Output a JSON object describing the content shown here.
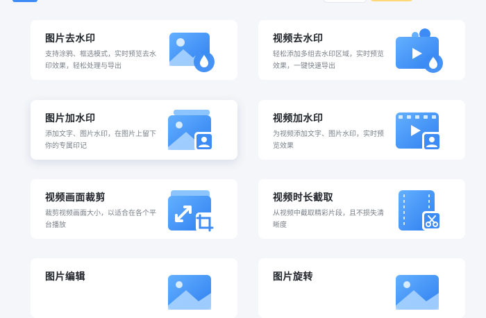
{
  "features": [
    {
      "title": "图片去水印",
      "desc": "支持涂鸦、框选模式，实时预览去水印效果，轻松处理与导出",
      "icon": "image-remove-watermark-icon"
    },
    {
      "title": "视频去水印",
      "desc": "轻松添加多组去水印区域，实时预览效果，一键快速导出",
      "icon": "video-remove-watermark-icon"
    },
    {
      "title": "图片加水印",
      "desc": "添加文字、图片水印，在图片上留下你的专属印记",
      "icon": "image-add-watermark-icon"
    },
    {
      "title": "视频加水印",
      "desc": "为视频添加文字、图片水印，实时预览效果",
      "icon": "video-add-watermark-icon"
    },
    {
      "title": "视频画面裁剪",
      "desc": "裁剪视频画面大小，以适合在各个平台播放",
      "icon": "video-crop-icon"
    },
    {
      "title": "视频时长截取",
      "desc": "从视频中截取精彩片段，且不损失清晰度",
      "icon": "video-trim-icon"
    },
    {
      "title": "图片编辑",
      "desc": "",
      "icon": "image-edit-icon"
    },
    {
      "title": "图片旋转",
      "desc": "",
      "icon": "image-rotate-icon"
    }
  ],
  "colors": {
    "accent": "#2f7ff0",
    "accent_light": "#8cc4ff",
    "page_bg": "#f4f6f9"
  }
}
